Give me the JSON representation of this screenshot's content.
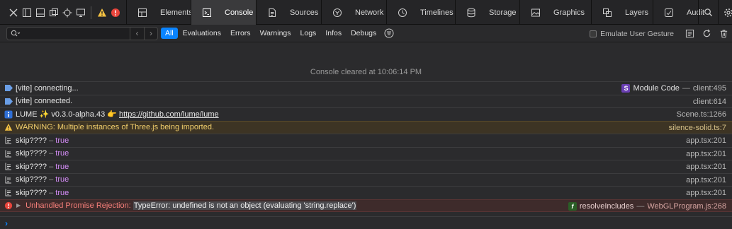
{
  "colors": {
    "accent": "#0a84ff",
    "warning": "#f2cf6c",
    "error": "#f77f7a",
    "true_value": "#d48cf7"
  },
  "toolbar": {
    "icons": [
      "close-icon",
      "dock-left-icon",
      "dock-bottom-icon",
      "dock-window-icon",
      "inspect-element-icon",
      "device-icon",
      "warning-icon",
      "error-icon"
    ]
  },
  "tabs": [
    {
      "label": "Elements",
      "icon": "elements-icon"
    },
    {
      "label": "Console",
      "icon": "console-icon",
      "active": true
    },
    {
      "label": "Sources",
      "icon": "sources-icon"
    },
    {
      "label": "Network",
      "icon": "network-icon"
    },
    {
      "label": "Timelines",
      "icon": "timelines-icon"
    },
    {
      "label": "Storage",
      "icon": "storage-icon"
    },
    {
      "label": "Graphics",
      "icon": "graphics-icon"
    },
    {
      "label": "Layers",
      "icon": "layers-icon"
    },
    {
      "label": "Audit",
      "icon": "audit-icon"
    }
  ],
  "filterbar": {
    "search_placeholder": "",
    "filters": [
      "All",
      "Evaluations",
      "Errors",
      "Warnings",
      "Logs",
      "Infos",
      "Debugs"
    ],
    "selected_filter": "All",
    "emulate_label": "Emulate User Gesture"
  },
  "console": {
    "cleared_message": "Console cleared at 10:06:14 PM",
    "rows": [
      {
        "type": "debug",
        "text": "[vite] connecting...",
        "badge": "S",
        "source_name": "Module Code",
        "source_sep": "—",
        "source": "client:495"
      },
      {
        "type": "debug",
        "text": "[vite] connected.",
        "source": "client:614"
      },
      {
        "type": "info",
        "text": "LUME ✨ v0.3.0-alpha.43 👉 ",
        "link": "https://github.com/lume/lume",
        "source": "Scene.ts:1266"
      },
      {
        "type": "warning",
        "text": "WARNING: Multiple instances of Three.js being imported.",
        "source": "silence-solid.ts:7"
      },
      {
        "type": "log",
        "text": "skip????",
        "dash": "–",
        "value": "true",
        "source": "app.tsx:201"
      },
      {
        "type": "log",
        "text": "skip????",
        "dash": "–",
        "value": "true",
        "source": "app.tsx:201"
      },
      {
        "type": "log",
        "text": "skip????",
        "dash": "–",
        "value": "true",
        "source": "app.tsx:201"
      },
      {
        "type": "log",
        "text": "skip????",
        "dash": "–",
        "value": "true",
        "source": "app.tsx:201"
      },
      {
        "type": "log",
        "text": "skip????",
        "dash": "–",
        "value": "true",
        "source": "app.tsx:201"
      },
      {
        "type": "error",
        "text": "Unhandled Promise Rejection: ",
        "selected": "TypeError: undefined is not an object (evaluating 'string.replace')",
        "badge": "f",
        "source_name": "resolveIncludes",
        "source_sep": "—",
        "source": "WebGLProgram.js:268"
      }
    ]
  }
}
